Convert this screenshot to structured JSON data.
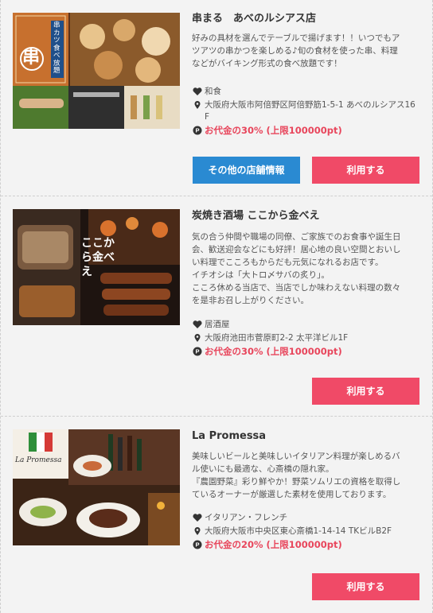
{
  "shops": [
    {
      "name": "串まる　あべのルシアス店",
      "description_lines": [
        "好みの具材を選んでテーブルで揚げます！！いつでもア",
        "ツアツの串かつを楽しめる♪旬の食材を使った串、料理",
        "などがバイキング形式の食べ放題です！"
      ],
      "genre": "和食",
      "address_lines": [
        "大阪府大阪市阿倍野区阿倍野筋1-5-1 あべのルシアス16",
        "F"
      ],
      "reward": "お代金の30% (上限100000pt)",
      "image_sign_text": "串カツ食べ放題",
      "image_logo_text": "串",
      "more_button": "その他の店舗情報",
      "use_button": "利用する"
    },
    {
      "name": "炭焼き酒場 ここから金べえ",
      "description_lines": [
        "気の合う仲間や職場の同僚、ご家族でのお食事や誕生日",
        "会、歓送迎会などにも好評！居心地の良い空間とおいし",
        "い料理でこころもからだも元気になれるお店です。",
        "イチオシは「大トロ〆サバの炙り」。",
        "こころ休める当店で、当店でしか味わえない料理の数々",
        "を是非お召し上がりください。"
      ],
      "genre": "居酒屋",
      "address_lines": [
        "大阪府池田市菅原町2-2 太平洋ビル1F"
      ],
      "reward": "お代金の30% (上限100000pt)",
      "image_logo_text": "ここから金べえ",
      "use_button": "利用する"
    },
    {
      "name": "La Promessa",
      "description_lines": [
        "美味しいビールと美味しいイタリアン料理が楽しめるバ",
        "ル使いにも最適な、心斎橋の隠れ家。",
        "『農園野菜』彩り鮮やか！野菜ソムリエの資格を取得し",
        "ているオーナーが厳選した素材を使用しております。"
      ],
      "genre": "イタリアン・フレンチ",
      "address_lines": [
        "大阪府大阪市中央区東心斎橋1-14-14 TKビルB2F"
      ],
      "reward": "お代金の20% (上限100000pt)",
      "image_logo_text": "La Promessa",
      "use_button": "利用する"
    }
  ],
  "colors": {
    "reward": "#e8465c",
    "button_pink": "#f04a67",
    "button_blue": "#2a8ad2"
  },
  "icons": {
    "genre": "heart-icon",
    "address": "map-pin-icon",
    "reward": "point-coin-icon"
  }
}
